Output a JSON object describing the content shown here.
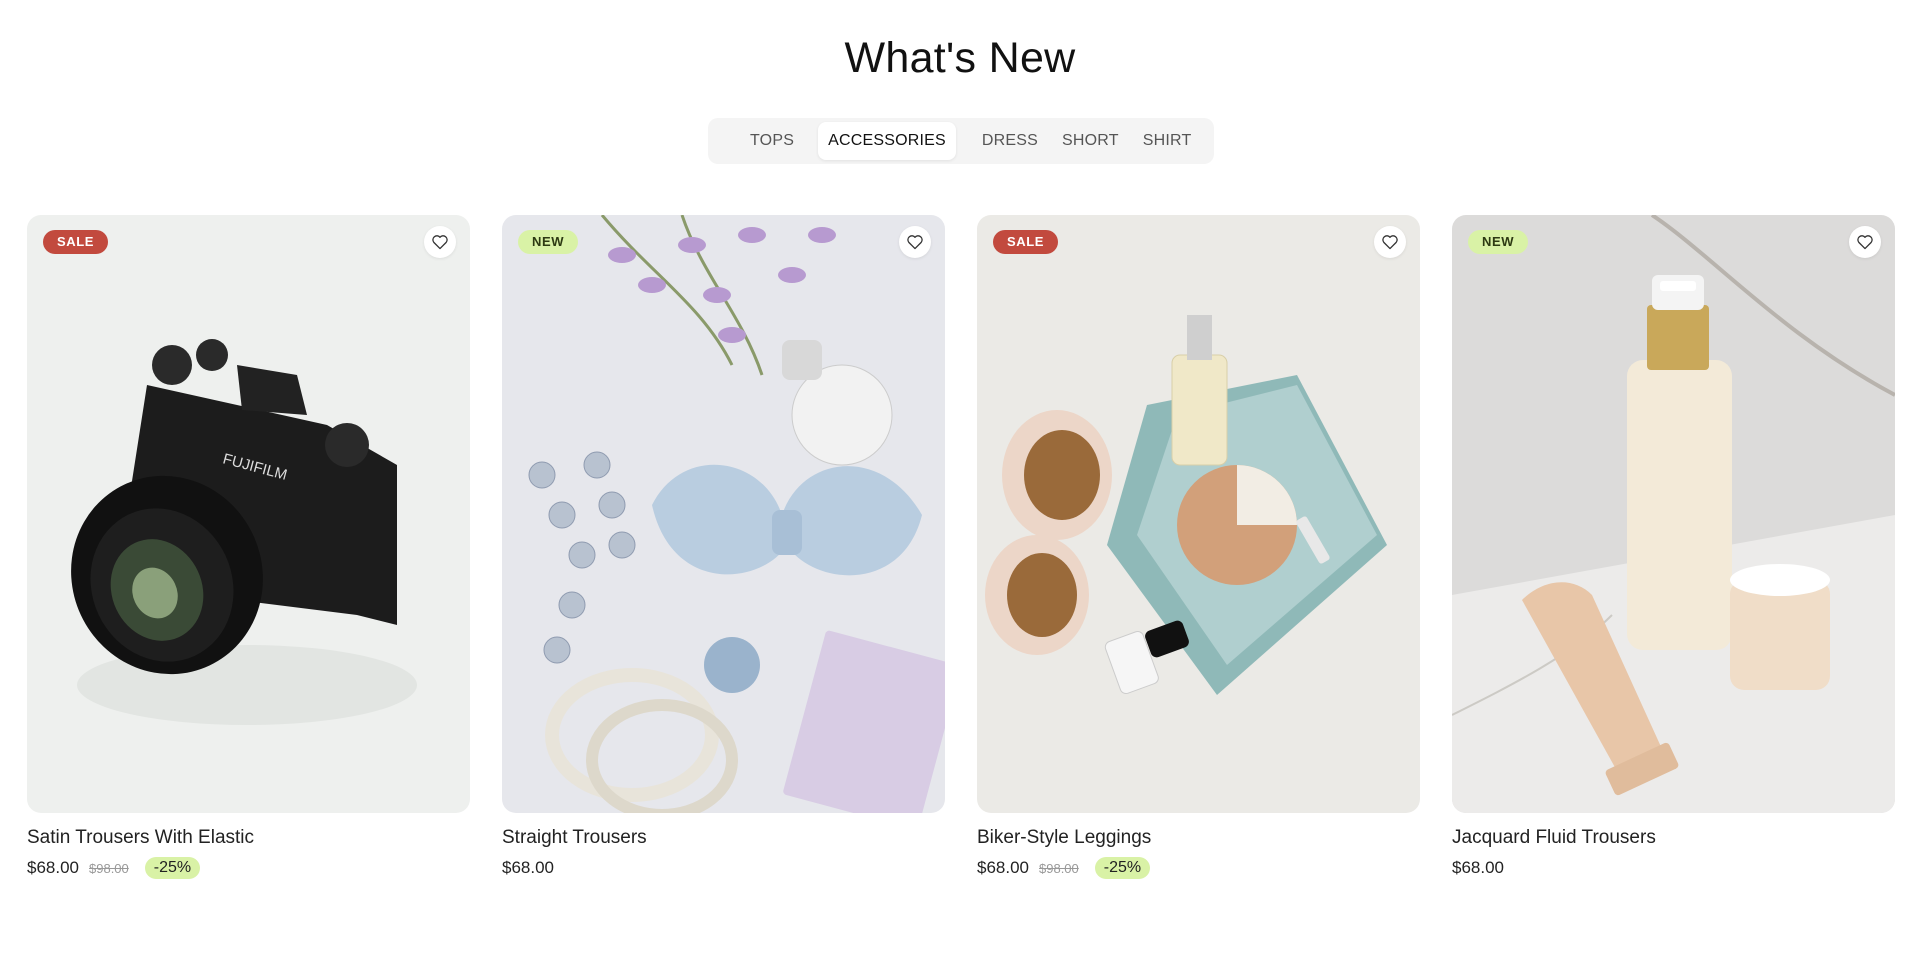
{
  "section": {
    "title": "What's New"
  },
  "tabs": [
    {
      "label": "TOPS",
      "active": false
    },
    {
      "label": "ACCESSORIES",
      "active": true
    },
    {
      "label": "DRESS",
      "active": false
    },
    {
      "label": "SHORT",
      "active": false
    },
    {
      "label": "SHIRT",
      "active": false
    }
  ],
  "products": [
    {
      "name": "Satin Trousers With Elastic",
      "price": "$68.00",
      "old_price": "$98.00",
      "discount": "-25%",
      "badge": "SALE",
      "image": "camera"
    },
    {
      "name": "Straight Trousers",
      "price": "$68.00",
      "old_price": "",
      "discount": "",
      "badge": "NEW",
      "image": "accessories-flatlay"
    },
    {
      "name": "Biker-Style Leggings",
      "price": "$68.00",
      "old_price": "$98.00",
      "discount": "-25%",
      "badge": "SALE",
      "image": "sunglasses-cosmetics"
    },
    {
      "name": "Jacquard Fluid Trousers",
      "price": "$68.00",
      "old_price": "",
      "discount": "",
      "badge": "NEW",
      "image": "skincare-bottles"
    }
  ],
  "colors": {
    "sale_badge": "#c24a3e",
    "new_badge": "#d9f2a6",
    "discount_pill": "#d9f2a6",
    "tab_bar": "#f4f4f4"
  },
  "icons": {
    "wishlist": "heart-icon"
  }
}
